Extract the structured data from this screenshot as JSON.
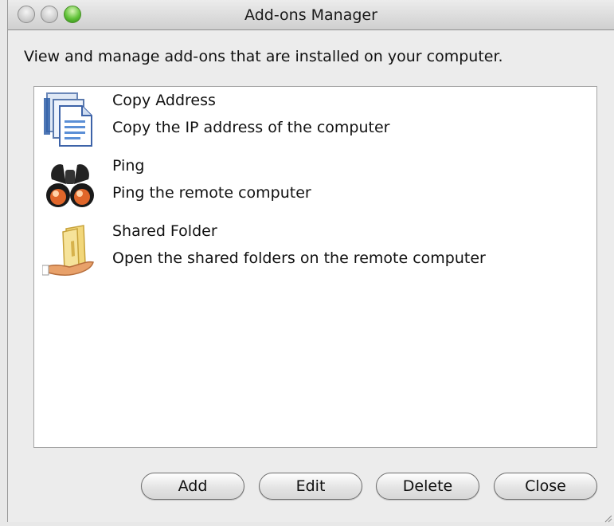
{
  "window": {
    "title": "Add-ons Manager",
    "controls": [
      "close",
      "minimize",
      "zoom"
    ]
  },
  "header": {
    "text": "View and manage add-ons that are installed on your computer."
  },
  "addons": [
    {
      "name": "Copy Address",
      "description": "Copy the IP address of the computer",
      "icon": "document-copy-icon"
    },
    {
      "name": "Ping",
      "description": "Ping the remote computer",
      "icon": "binoculars-icon"
    },
    {
      "name": "Shared Folder",
      "description": "Open the shared folders on the remote computer",
      "icon": "shared-folder-hand-icon"
    }
  ],
  "buttons": {
    "add": "Add",
    "edit": "Edit",
    "delete": "Delete",
    "close": "Close"
  },
  "colors": {
    "zoom_green": "#62c33a",
    "window_bg": "#ececec",
    "list_bg": "#ffffff"
  }
}
